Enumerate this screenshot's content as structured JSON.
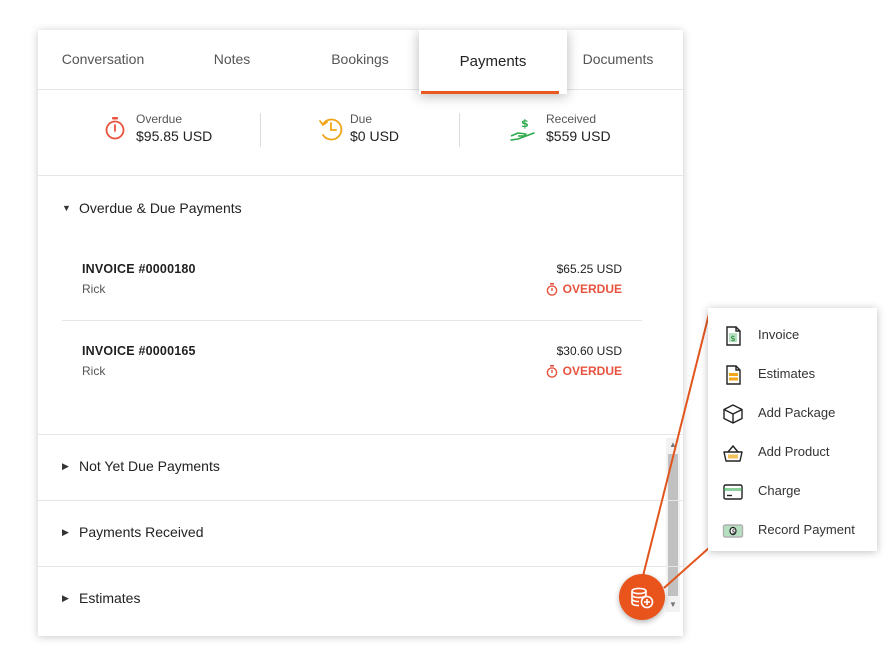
{
  "tabs": [
    {
      "label": "Conversation"
    },
    {
      "label": "Notes"
    },
    {
      "label": "Bookings"
    },
    {
      "label": "Payments",
      "active": true
    },
    {
      "label": "Documents"
    }
  ],
  "summary": {
    "overdue": {
      "label": "Overdue",
      "value": "$95.85 USD"
    },
    "due": {
      "label": "Due",
      "value": "$0 USD"
    },
    "received": {
      "label": "Received",
      "value": "$559 USD"
    }
  },
  "sections": {
    "overdue_due": "Overdue & Due Payments",
    "not_yet_due": "Not Yet Due Payments",
    "received": "Payments Received",
    "estimates": "Estimates"
  },
  "invoices": [
    {
      "number": "INVOICE #0000180",
      "customer": "Rick",
      "amount": "$65.25 USD",
      "status": "OVERDUE"
    },
    {
      "number": "INVOICE #0000165",
      "customer": "Rick",
      "amount": "$30.60 USD",
      "status": "OVERDUE"
    }
  ],
  "action_menu": {
    "items": [
      {
        "label": "Invoice",
        "icon": "invoice-icon"
      },
      {
        "label": "Estimates",
        "icon": "estimates-icon"
      },
      {
        "label": "Add Package",
        "icon": "package-icon"
      },
      {
        "label": "Add Product",
        "icon": "basket-icon"
      },
      {
        "label": "Charge",
        "icon": "card-icon"
      },
      {
        "label": "Record Payment",
        "icon": "cash-icon"
      }
    ]
  },
  "colors": {
    "accent": "#e9541d",
    "overdue": "#e8533f",
    "due": "#f0a51a",
    "received": "#2ba84a"
  }
}
